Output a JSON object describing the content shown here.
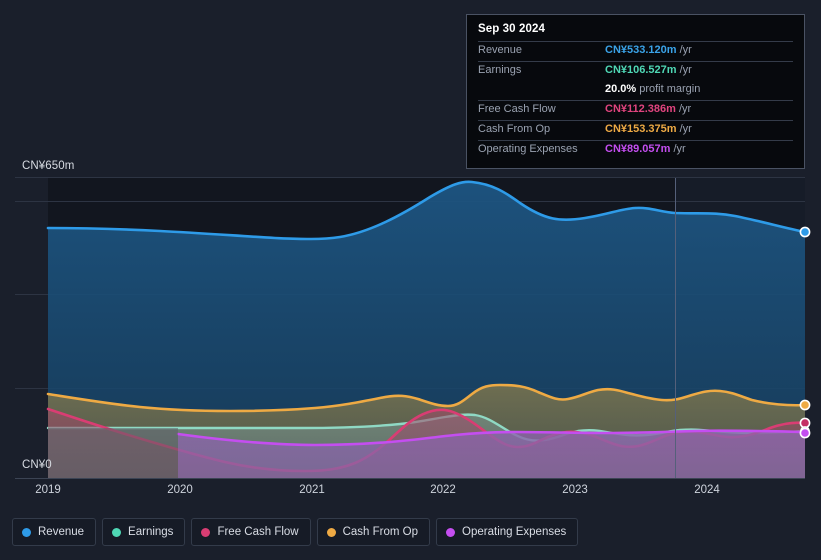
{
  "tooltip": {
    "date": "Sep 30 2024",
    "rows": [
      {
        "key": "Revenue",
        "value": "CN¥533.120m",
        "unit": "/yr",
        "color": "#3aa3e8"
      },
      {
        "key": "Earnings",
        "value": "CN¥106.527m",
        "unit": "/yr",
        "color": "#4fd8b5"
      },
      {
        "key": "",
        "value": "20.0%",
        "unit": "profit margin",
        "color": "#ffffff",
        "no_rule": true
      },
      {
        "key": "Free Cash Flow",
        "value": "CN¥112.386m",
        "unit": "/yr",
        "color": "#e0447e"
      },
      {
        "key": "Cash From Op",
        "value": "CN¥153.375m",
        "unit": "/yr",
        "color": "#eeaa44"
      },
      {
        "key": "Operating Expenses",
        "value": "CN¥89.057m",
        "unit": "/yr",
        "color": "#c44ef0"
      }
    ]
  },
  "axis": {
    "y_max_label": "CN¥650m",
    "y_zero_label": "CN¥0",
    "x_ticks": [
      "2019",
      "2020",
      "2021",
      "2022",
      "2023",
      "2024"
    ]
  },
  "legend": {
    "items": [
      {
        "label": "Revenue",
        "color": "#2e9be8"
      },
      {
        "label": "Earnings",
        "color": "#4fd8b5"
      },
      {
        "label": "Free Cash Flow",
        "color": "#d93d73"
      },
      {
        "label": "Cash From Op",
        "color": "#eeaa44"
      },
      {
        "label": "Operating Expenses",
        "color": "#c44ef0"
      }
    ]
  },
  "colors": {
    "background": "#1a1f2b",
    "plot_background": "#12161f",
    "gridline": "#2d3443",
    "revenue": "#2e9be8",
    "earnings": "#4fd8b5",
    "free_cash_flow": "#d93d73",
    "cash_from_op": "#eeaa44",
    "operating_expenses": "#c44ef0"
  },
  "chart_data": {
    "type": "area",
    "title": "",
    "subtitle": "",
    "xlabel": "",
    "ylabel": "",
    "currency": "CN¥",
    "units": "millions per year",
    "ylim": [
      0,
      650
    ],
    "yticks": [
      0,
      650
    ],
    "ytick_labels": [
      "CN¥0",
      "CN¥650m"
    ],
    "grid": true,
    "legend_position": "bottom",
    "x_range": [
      "2019",
      "2024-09-30"
    ],
    "x_tick_labels": [
      "2019",
      "2020",
      "2021",
      "2022",
      "2023",
      "2024"
    ],
    "highlight_date": "Sep 30 2024",
    "x": [
      2018.87,
      2019.2,
      2019.6,
      2020.0,
      2020.35,
      2020.7,
      2021.0,
      2021.35,
      2021.7,
      2022.0,
      2022.2,
      2022.45,
      2022.7,
      2023.0,
      2023.25,
      2023.5,
      2023.8,
      2024.1,
      2024.4,
      2024.75
    ],
    "series": [
      {
        "name": "Revenue",
        "color": "#2e9be8",
        "values": [
          530,
          528,
          524,
          521,
          512,
          500,
          496,
          520,
          570,
          600,
          604,
          588,
          560,
          540,
          548,
          556,
          550,
          552,
          546,
          533
        ]
      },
      {
        "name": "Cash From Op",
        "color": "#eeaa44",
        "values": [
          182,
          168,
          154,
          146,
          141,
          140,
          140,
          142,
          152,
          172,
          164,
          150,
          186,
          196,
          172,
          164,
          180,
          186,
          168,
          153
        ]
      },
      {
        "name": "Free Cash Flow",
        "color": "#d93d73",
        "values": [
          148,
          123,
          96,
          74,
          52,
          34,
          24,
          24,
          40,
          70,
          110,
          138,
          130,
          104,
          86,
          96,
          116,
          110,
          122,
          112
        ]
      },
      {
        "name": "Earnings",
        "color": "#4fd8b5",
        "values": [
          106,
          106,
          106,
          106,
          106,
          105,
          104,
          104,
          106,
          116,
          128,
          134,
          130,
          116,
          100,
          94,
          98,
          102,
          108,
          107
        ]
      },
      {
        "name": "Operating Expenses",
        "color": "#c44ef0",
        "values": [
          null,
          null,
          null,
          96,
          88,
          82,
          78,
          78,
          80,
          84,
          88,
          90,
          90,
          89,
          88,
          88,
          90,
          92,
          92,
          89
        ]
      }
    ],
    "end_markers": [
      {
        "series": "Revenue",
        "value": 533.12
      },
      {
        "series": "Cash From Op",
        "value": 153.375
      },
      {
        "series": "Free Cash Flow",
        "value": 112.386
      },
      {
        "series": "Earnings",
        "value": 106.527
      },
      {
        "series": "Operating Expenses",
        "value": 89.057
      }
    ]
  }
}
